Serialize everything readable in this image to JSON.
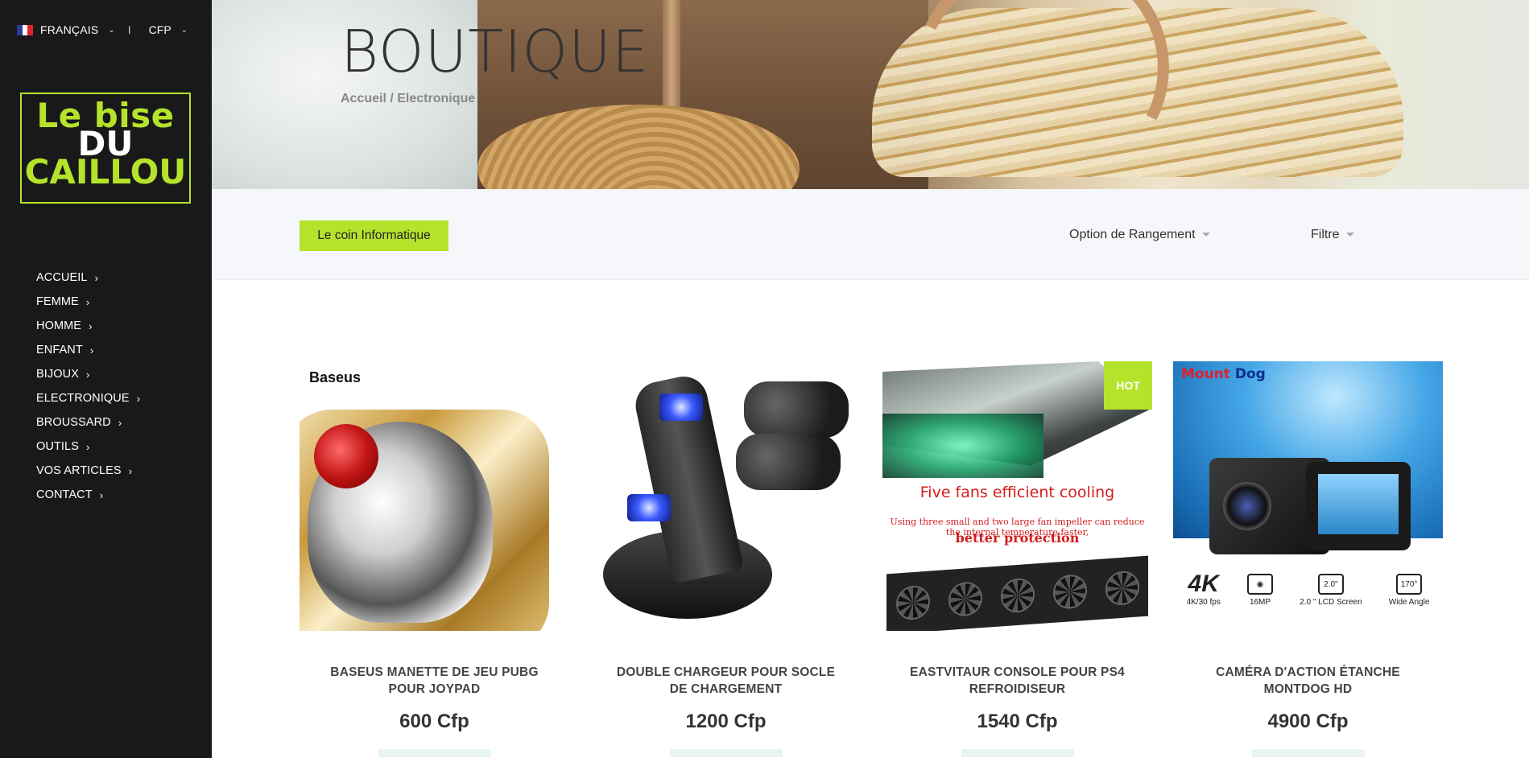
{
  "topbar": {
    "language": "FRANÇAIS",
    "separator": "I",
    "currency": "CFP",
    "flag_colors": [
      "#2b3a9a",
      "#ffffff",
      "#e0222a"
    ]
  },
  "logo": {
    "line1": "Le bise",
    "line2": "DU",
    "line3": "CAILLOU",
    "accent_color": "#b5e32b"
  },
  "nav": {
    "items": [
      {
        "label": "ACCUEIL"
      },
      {
        "label": "FEMME"
      },
      {
        "label": "HOMME"
      },
      {
        "label": "ENFANT"
      },
      {
        "label": "BIJOUX"
      },
      {
        "label": "ELECTRONIQUE"
      },
      {
        "label": "BROUSSARD"
      },
      {
        "label": "OUTILS"
      },
      {
        "label": "VOS ARTICLES"
      },
      {
        "label": "CONTACT"
      }
    ],
    "arrow": "›"
  },
  "hero": {
    "title": "BOUTIQUE",
    "breadcrumb": "Accueil / Electronique"
  },
  "toolbar": {
    "category_tag": "Le coin Informatique",
    "sort_label": "Option de Rangement",
    "filter_label": "Filtre"
  },
  "products": [
    {
      "name": "BASEUS MANETTE DE JEU PUBG POUR JOYPAD",
      "price": "600 Cfp",
      "brand": "Baseus"
    },
    {
      "name": "DOUBLE CHARGEUR POUR SOCLE DE CHARGEMENT",
      "price": "1200 Cfp"
    },
    {
      "name": "EASTVITAUR CONSOLE POUR PS4 REFROIDISEUR",
      "price": "1540 Cfp",
      "badge": "HOT",
      "image_text": {
        "headline": "Five fans  efficient cooling",
        "line2": "Using three small and two large fan impeller can reduce the internal temperature faster,",
        "line3": "better protection"
      }
    },
    {
      "name": "CAMÉRA D'ACTION ÉTANCHE MONTDOG HD",
      "price": "4900 Cfp",
      "image_text": {
        "brand_a": "Mount",
        "brand_b": " Dog",
        "spec1_big": "4K",
        "spec1_sub": "4K/30 fps",
        "spec2_sub": "16MP",
        "spec3_icon": "2.0\"",
        "spec3_sub": "2.0 \" LCD Screen",
        "spec4_icon": "170°",
        "spec4_sub": "Wide Angle"
      }
    }
  ]
}
